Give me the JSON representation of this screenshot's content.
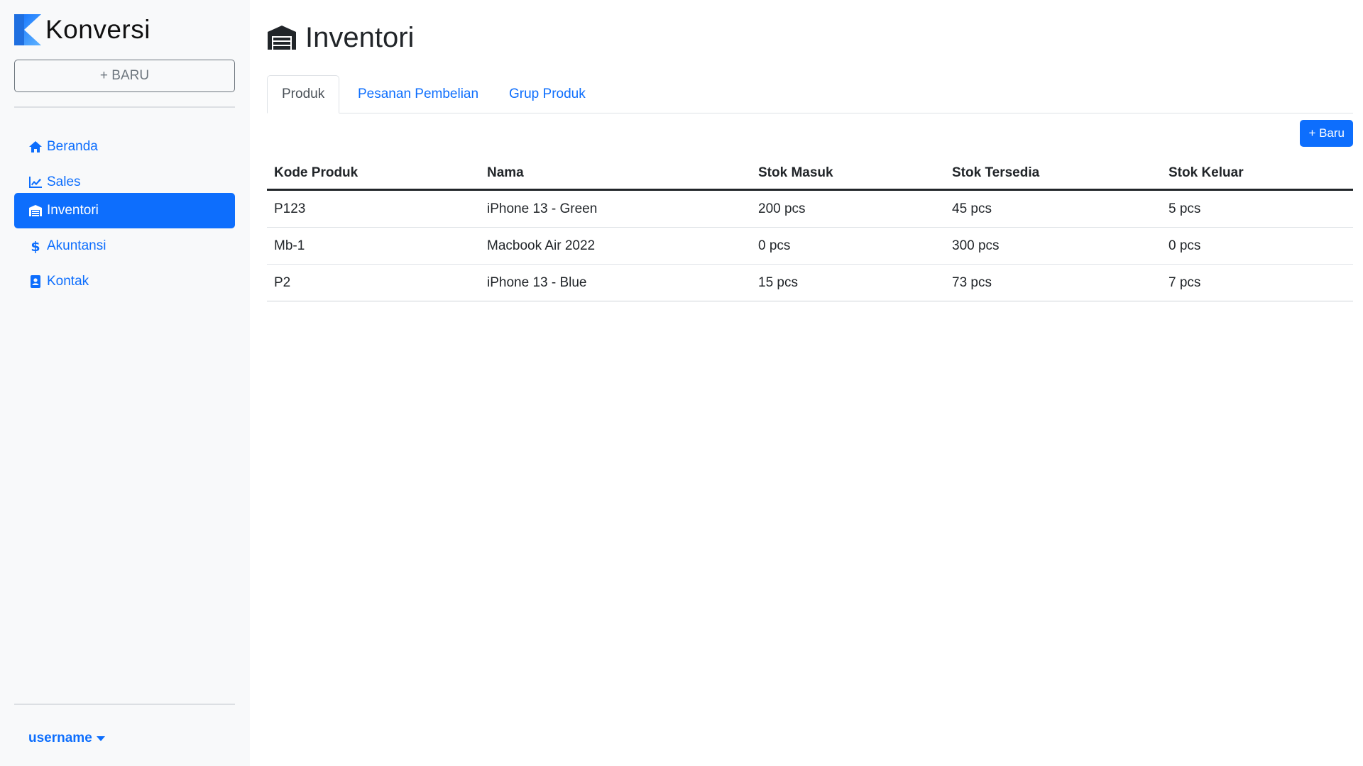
{
  "brand": {
    "name": "Konversi",
    "logo_colors": [
      "#0d6efd",
      "#5fb3ff"
    ]
  },
  "sidebar": {
    "new_button": "+ BARU",
    "items": [
      {
        "label": "Beranda",
        "icon": "home-icon",
        "active": false
      },
      {
        "label": "Sales",
        "icon": "chart-line-icon",
        "active": false
      },
      {
        "label": "Inventori",
        "icon": "warehouse-icon",
        "active": true
      },
      {
        "label": "Akuntansi",
        "icon": "dollar-icon",
        "active": false
      },
      {
        "label": "Kontak",
        "icon": "contact-card-icon",
        "active": false
      }
    ],
    "user": "username"
  },
  "page": {
    "title": "Inventori",
    "title_icon": "warehouse-icon",
    "tabs": [
      {
        "label": "Produk",
        "active": true
      },
      {
        "label": "Pesanan Pembelian",
        "active": false
      },
      {
        "label": "Grup Produk",
        "active": false
      }
    ],
    "new_button": "+ Baru"
  },
  "table": {
    "columns": [
      "Kode Produk",
      "Nama",
      "Stok Masuk",
      "Stok Tersedia",
      "Stok Keluar"
    ],
    "rows": [
      [
        "P123",
        "iPhone 13 - Green",
        "200 pcs",
        "45 pcs",
        "5 pcs"
      ],
      [
        "Mb-1",
        "Macbook Air 2022",
        "0 pcs",
        "300 pcs",
        "0 pcs"
      ],
      [
        "P2",
        "iPhone 13 - Blue",
        "15 pcs",
        "73 pcs",
        "7 pcs"
      ]
    ]
  },
  "colors": {
    "accent": "#0d6efd",
    "sidebar_bg": "#f8f9fa",
    "text": "#212529"
  }
}
